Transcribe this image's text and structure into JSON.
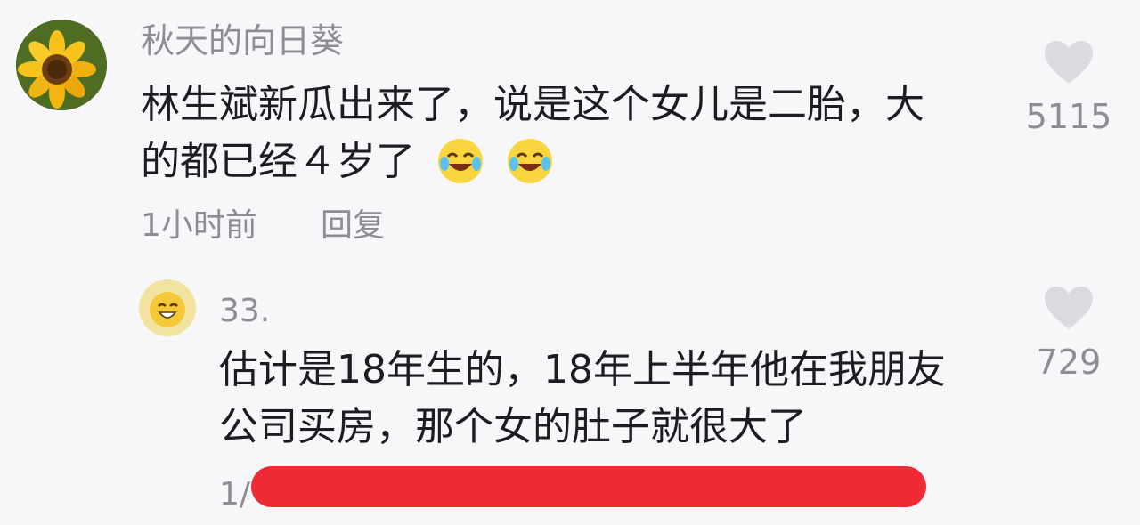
{
  "comments": [
    {
      "username": "秋天的向日葵",
      "avatar_icon": "sunflower-avatar",
      "text_lines": [
        "林生斌新瓜出来了，说是这个女儿是二胎，大",
        "的都已经４岁了"
      ],
      "trailing_emojis": [
        "laugh-cry-emoji",
        "laugh-cry-emoji"
      ],
      "time": "1小时前",
      "reply_label": "回复",
      "likes": "5115",
      "like_icon": "heart-icon"
    }
  ],
  "reply": {
    "username": "33.",
    "avatar_icon": "emoji-avatar",
    "text_lines": [
      "估计是18年生的，18年上半年他在我朋友",
      "公司买房，那个女的肚子就很大了"
    ],
    "time_partial": "1/",
    "likes": "729",
    "like_icon": "heart-icon",
    "redaction_color": "#ee2b35"
  },
  "colors": {
    "background": "#f7f7f9",
    "text": "#1d1d21",
    "meta": "#8d8d93",
    "heart": "#dcdce0"
  }
}
